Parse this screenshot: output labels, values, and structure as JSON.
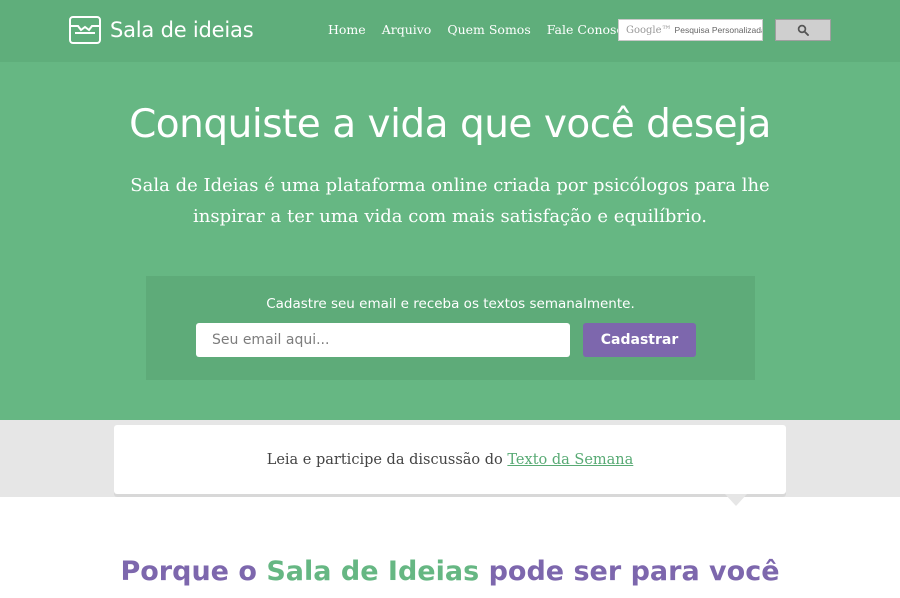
{
  "header": {
    "logo_text": "Sala de ideias",
    "nav": [
      {
        "label": "Home"
      },
      {
        "label": "Arquivo"
      },
      {
        "label": "Quem Somos"
      },
      {
        "label": "Fale Conosco"
      }
    ],
    "search": {
      "google_label": "Google™",
      "placeholder": "Pesquisa Personalizada",
      "button_icon": "search-icon"
    }
  },
  "hero": {
    "title": "Conquiste a vida que você deseja",
    "subtitle": "Sala de Ideias é uma plataforma online criada por psicólogos para lhe inspirar a ter uma vida com mais satisfação e equilíbrio.",
    "signup": {
      "label": "Cadastre seu email e receba os textos semanalmente.",
      "email_placeholder": "Seu email aqui...",
      "button_label": "Cadastrar"
    }
  },
  "callout": {
    "text": "Leia e participe da discussão do",
    "link_text": "Texto da Semana"
  },
  "why": {
    "part1": "Porque o",
    "part2": "Sala de Ideias",
    "part3": "pode ser para você"
  },
  "colors": {
    "header_bg": "#5fae7b",
    "hero_bg": "#66b783",
    "accent_purple": "#7d67ad",
    "accent_green": "#66b783",
    "band_gray": "#e6e6e6"
  }
}
